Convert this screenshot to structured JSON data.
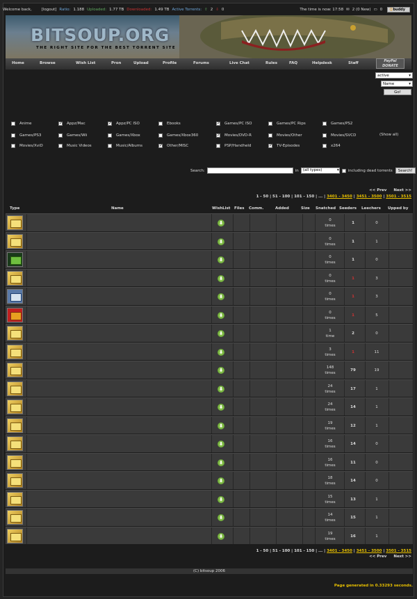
{
  "topbar": {
    "welcome": "Welcome back,",
    "logout": "[logout]",
    "ratio_label": "Ratio:",
    "ratio": "1.188",
    "uploaded_label": "Uploaded:",
    "uploaded": "1.77 TB",
    "downloaded_label": "Downloaded:",
    "downloaded": "1.49 TB",
    "active_label": "Active Torrents:",
    "active_up": "2",
    "active_down": "0",
    "time": "The time is now: 17:58",
    "messages": "2 (0 New)",
    "inbox": "0",
    "buddy": "buddy"
  },
  "banner": {
    "logo": "BITSOUP.ORG",
    "slogan": "THE RIGHT SITE FOR THE BEST TORRENT SITE"
  },
  "nav": [
    "Home",
    "Browse",
    "Wish List",
    "Pron",
    "Upload",
    "Profile",
    "Forums",
    "Live Chat",
    "Rules",
    "FAQ",
    "Helpdesk",
    "Staff"
  ],
  "paypal": {
    "title": "PayPal",
    "sub": "DONATE"
  },
  "filters": {
    "status": "active",
    "sort": "Name",
    "go": "Go!"
  },
  "categories": [
    {
      "label": "Anime",
      "checked": false
    },
    {
      "label": "Appz/Mac",
      "checked": true
    },
    {
      "label": "Appz/PC ISO",
      "checked": true
    },
    {
      "label": "Ebooks",
      "checked": false
    },
    {
      "label": "Games/PC ISO",
      "checked": true
    },
    {
      "label": "Games/PC Rips",
      "checked": false
    },
    {
      "label": "Games/PS2",
      "checked": false
    },
    {
      "label": "Games/PS3",
      "checked": false
    },
    {
      "label": "Games/Wii",
      "checked": false
    },
    {
      "label": "Games/Xbox",
      "checked": false
    },
    {
      "label": "Games/Xbox360",
      "checked": false
    },
    {
      "label": "Movies/DVD-R",
      "checked": true
    },
    {
      "label": "Movies/Other",
      "checked": false
    },
    {
      "label": "Movies/SVCD",
      "checked": false
    },
    {
      "label": "Movies/XviD",
      "checked": false
    },
    {
      "label": "Music Videos",
      "checked": false
    },
    {
      "label": "Music/Albums",
      "checked": false
    },
    {
      "label": "Other/MISC",
      "checked": true
    },
    {
      "label": "PSP/Handheld",
      "checked": false
    },
    {
      "label": "TV-Episodes",
      "checked": true
    },
    {
      "label": "x264",
      "checked": false
    }
  ],
  "show_all": "(Show all)",
  "search": {
    "label": "Search:",
    "in": "in",
    "type": "(all types)",
    "dead": "including dead torrents",
    "button": "Search!"
  },
  "pager": {
    "prev": "<< Prev",
    "next": "Next >>",
    "pages": "1 - 50 | 51 - 100 | 101 - 150 | ... |",
    "p1": "3401 - 3450",
    "p2": "3451 - 3500",
    "p3": "3501 - 3515"
  },
  "columns": {
    "type": "Type",
    "name": "Name",
    "wishlist": "WishList",
    "files": "Files",
    "comm": "Comm.",
    "added": "Added",
    "size": "Size",
    "snatched": "Snatched",
    "seeders": "Seeders",
    "leechers": "Leechers",
    "upped": "Upped by"
  },
  "rows": [
    {
      "icon": "folder",
      "snatched": "0",
      "unit": "times",
      "seeders": "1",
      "leechers": "0",
      "red": false
    },
    {
      "icon": "folder",
      "snatched": "0",
      "unit": "times",
      "seeders": "1",
      "leechers": "1",
      "red": false
    },
    {
      "icon": "tv",
      "snatched": "0",
      "unit": "times",
      "seeders": "1",
      "leechers": "0",
      "red": false
    },
    {
      "icon": "folder",
      "snatched": "0",
      "unit": "times",
      "seeders": "1",
      "leechers": "3",
      "red": true
    },
    {
      "icon": "disk",
      "snatched": "0",
      "unit": "times",
      "seeders": "1",
      "leechers": "3",
      "red": true
    },
    {
      "icon": "dvd",
      "snatched": "0",
      "unit": "times",
      "seeders": "1",
      "leechers": "5",
      "red": true
    },
    {
      "icon": "folder",
      "snatched": "1",
      "unit": "time",
      "seeders": "2",
      "leechers": "0",
      "red": false
    },
    {
      "icon": "folder",
      "snatched": "3",
      "unit": "times",
      "seeders": "1",
      "leechers": "11",
      "red": true
    },
    {
      "icon": "folder",
      "snatched": "148",
      "unit": "times",
      "seeders": "79",
      "leechers": "19",
      "red": false
    },
    {
      "icon": "folder",
      "snatched": "24",
      "unit": "times",
      "seeders": "17",
      "leechers": "1",
      "red": false
    },
    {
      "icon": "folder",
      "snatched": "24",
      "unit": "times",
      "seeders": "14",
      "leechers": "1",
      "red": false
    },
    {
      "icon": "folder",
      "snatched": "19",
      "unit": "times",
      "seeders": "12",
      "leechers": "1",
      "red": false
    },
    {
      "icon": "folder",
      "snatched": "16",
      "unit": "times",
      "seeders": "14",
      "leechers": "0",
      "red": false
    },
    {
      "icon": "folder",
      "snatched": "16",
      "unit": "times",
      "seeders": "11",
      "leechers": "0",
      "red": false
    },
    {
      "icon": "folder",
      "snatched": "18",
      "unit": "times",
      "seeders": "14",
      "leechers": "0",
      "red": false
    },
    {
      "icon": "folder",
      "snatched": "15",
      "unit": "times",
      "seeders": "13",
      "leechers": "1",
      "red": false
    },
    {
      "icon": "folder",
      "snatched": "14",
      "unit": "times",
      "seeders": "15",
      "leechers": "1",
      "red": false
    },
    {
      "icon": "folder",
      "snatched": "19",
      "unit": "times",
      "seeders": "16",
      "leechers": "1",
      "red": false
    }
  ],
  "footer": "(C) bitsoup 2006",
  "generated": "Page generated in 0.33293 seconds."
}
